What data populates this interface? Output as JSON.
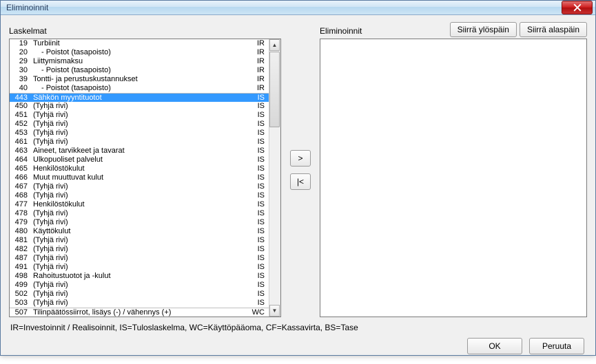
{
  "window": {
    "title": "Eliminoinnit"
  },
  "labels": {
    "left": "Laskelmat",
    "right": "Eliminoinnit"
  },
  "buttons": {
    "moveUp": "Siirrä ylöspäin",
    "moveDown": "Siirrä alaspäin",
    "addArrow": ">",
    "removeArrow": "|<",
    "ok": "OK",
    "cancel": "Peruuta"
  },
  "legend": "IR=Investoinnit / Realisoinnit, IS=Tuloslaskelma, WC=Käyttöpääoma, CF=Kassavirta, BS=Tase",
  "rows": [
    {
      "num": "19",
      "name": "Turbiinit",
      "tag": "IR",
      "indent": 0,
      "selected": false
    },
    {
      "num": "20",
      "name": "- Poistot (tasapoisto)",
      "tag": "IR",
      "indent": 1,
      "selected": false
    },
    {
      "num": "29",
      "name": "Liittymismaksu",
      "tag": "IR",
      "indent": 0,
      "selected": false
    },
    {
      "num": "30",
      "name": "- Poistot (tasapoisto)",
      "tag": "IR",
      "indent": 1,
      "selected": false
    },
    {
      "num": "39",
      "name": "Tontti- ja perustuskustannukset",
      "tag": "IR",
      "indent": 0,
      "selected": false
    },
    {
      "num": "40",
      "name": "- Poistot (tasapoisto)",
      "tag": "IR",
      "indent": 1,
      "selected": false
    },
    {
      "num": "443",
      "name": "Sähkön myyntituotot",
      "tag": "IS",
      "indent": 0,
      "selected": true,
      "topline": true
    },
    {
      "num": "450",
      "name": "(Tyhjä rivi)",
      "tag": "IS",
      "indent": 0,
      "selected": false
    },
    {
      "num": "451",
      "name": "(Tyhjä rivi)",
      "tag": "IS",
      "indent": 0,
      "selected": false
    },
    {
      "num": "452",
      "name": "(Tyhjä rivi)",
      "tag": "IS",
      "indent": 0,
      "selected": false
    },
    {
      "num": "453",
      "name": "(Tyhjä rivi)",
      "tag": "IS",
      "indent": 0,
      "selected": false
    },
    {
      "num": "461",
      "name": "(Tyhjä rivi)",
      "tag": "IS",
      "indent": 0,
      "selected": false
    },
    {
      "num": "463",
      "name": "Aineet, tarvikkeet ja tavarat",
      "tag": "IS",
      "indent": 0,
      "selected": false
    },
    {
      "num": "464",
      "name": "Ulkopuoliset palvelut",
      "tag": "IS",
      "indent": 0,
      "selected": false
    },
    {
      "num": "465",
      "name": "Henkilöstökulut",
      "tag": "IS",
      "indent": 0,
      "selected": false
    },
    {
      "num": "466",
      "name": "Muut muuttuvat kulut",
      "tag": "IS",
      "indent": 0,
      "selected": false
    },
    {
      "num": "467",
      "name": "(Tyhjä rivi)",
      "tag": "IS",
      "indent": 0,
      "selected": false
    },
    {
      "num": "468",
      "name": "(Tyhjä rivi)",
      "tag": "IS",
      "indent": 0,
      "selected": false
    },
    {
      "num": "477",
      "name": "Henkilöstökulut",
      "tag": "IS",
      "indent": 0,
      "selected": false
    },
    {
      "num": "478",
      "name": "(Tyhjä rivi)",
      "tag": "IS",
      "indent": 0,
      "selected": false
    },
    {
      "num": "479",
      "name": "(Tyhjä rivi)",
      "tag": "IS",
      "indent": 0,
      "selected": false
    },
    {
      "num": "480",
      "name": "Käyttökulut",
      "tag": "IS",
      "indent": 0,
      "selected": false
    },
    {
      "num": "481",
      "name": "(Tyhjä rivi)",
      "tag": "IS",
      "indent": 0,
      "selected": false
    },
    {
      "num": "482",
      "name": "(Tyhjä rivi)",
      "tag": "IS",
      "indent": 0,
      "selected": false
    },
    {
      "num": "487",
      "name": "(Tyhjä rivi)",
      "tag": "IS",
      "indent": 0,
      "selected": false
    },
    {
      "num": "491",
      "name": "(Tyhjä rivi)",
      "tag": "IS",
      "indent": 0,
      "selected": false
    },
    {
      "num": "498",
      "name": "Rahoitustuotot ja -kulut",
      "tag": "IS",
      "indent": 0,
      "selected": false
    },
    {
      "num": "499",
      "name": "(Tyhjä rivi)",
      "tag": "IS",
      "indent": 0,
      "selected": false
    },
    {
      "num": "502",
      "name": "(Tyhjä rivi)",
      "tag": "IS",
      "indent": 0,
      "selected": false
    },
    {
      "num": "503",
      "name": "(Tyhjä rivi)",
      "tag": "IS",
      "indent": 0,
      "selected": false
    },
    {
      "num": "507",
      "name": "Tilinpäätössiirrot, lisäys (-) / vähennys (+)",
      "tag": "WC",
      "indent": 0,
      "selected": false,
      "topline": true
    }
  ]
}
